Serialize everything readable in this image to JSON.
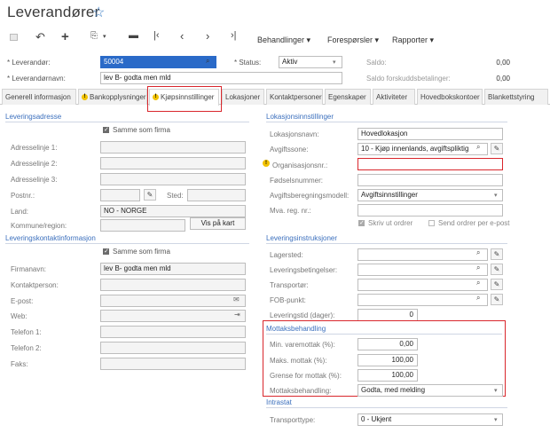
{
  "page": {
    "title": "Leverandører"
  },
  "toolbar": {
    "menus": [
      "Behandlinger",
      "Forespørsler",
      "Rapporter"
    ]
  },
  "header": {
    "supplier_label": "* Leverandør:",
    "supplier_value": "50004",
    "status_label": "* Status:",
    "status_value": "Aktiv",
    "balance_label": "Saldo:",
    "balance_value": "0,00",
    "name_label": "* Leverandørnavn:",
    "name_value": "lev B- godta men mld",
    "prepay_label": "Saldo forskuddsbetalinger:",
    "prepay_value": "0,00"
  },
  "tabs": [
    "Generell informasjon",
    "Bankopplysninger",
    "Kjøpsinnstillinger",
    "Lokasjoner",
    "Kontaktpersoner",
    "Egenskaper",
    "Aktiviteter",
    "Hovedbokskontoer",
    "Blankettstyring"
  ],
  "left": {
    "delivery_address_title": "Leveringsadresse",
    "same_as_company": "Samme som firma",
    "address1": "Adresselinje 1:",
    "address2": "Adresselinje 2:",
    "address3": "Adresselinje 3:",
    "postal": "Postnr.:",
    "place": "Sted:",
    "country_label": "Land:",
    "country_value": "NO - NORGE",
    "region_label": "Kommune/region:",
    "map_button": "Vis på kart",
    "contact_title": "Leveringskontaktinformasjon",
    "same_as_company2": "Samme som firma",
    "company_name_label": "Firmanavn:",
    "company_name_value": "lev B- godta men mld",
    "contact_person": "Kontaktperson:",
    "email": "E-post:",
    "web": "Web:",
    "phone1": "Telefon 1:",
    "phone2": "Telefon 2:",
    "fax": "Faks:"
  },
  "right": {
    "location_title": "Lokasjonsinnstillinger",
    "location_name_label": "Lokasjonsnavn:",
    "location_name_value": "Hovedlokasjon",
    "tax_zone_label": "Avgiftssone:",
    "tax_zone_value": "10 - Kjøp innenlands, avgiftspliktig",
    "org_no_label": "Organisasjonsnr.:",
    "birth_no_label": "Fødselsnummer:",
    "tax_model_label": "Avgiftsberegningsmodell:",
    "tax_model_value": "Avgiftsinnstillinger",
    "vat_label": "Mva. reg. nr.:",
    "print_orders": "Skriv ut ordrer",
    "send_orders": "Send ordrer per e-post",
    "delivery_instr_title": "Leveringsinstruksjoner",
    "warehouse_label": "Lagersted:",
    "terms_label": "Leveringsbetingelser:",
    "carrier_label": "Transportør:",
    "fob_label": "FOB-punkt:",
    "lead_time_label": "Leveringstid (dager):",
    "lead_time_value": "0",
    "receipt_title": "Mottaksbehandling",
    "min_receipt_label": "Min. varemottak (%):",
    "min_receipt_value": "0,00",
    "max_receipt_label": "Maks. mottak (%):",
    "max_receipt_value": "100,00",
    "threshold_label": "Grense for mottak (%):",
    "threshold_value": "100,00",
    "receipt_action_label": "Mottaksbehandling:",
    "receipt_action_value": "Godta, med melding",
    "intrastat_title": "Intrastat",
    "transport_type_label": "Transporttype:",
    "transport_type_value": "0 - Ukjent"
  },
  "colors": {
    "accent": "#3b6fbd",
    "highlight": "#d9262c",
    "warning": "#f2c200"
  }
}
